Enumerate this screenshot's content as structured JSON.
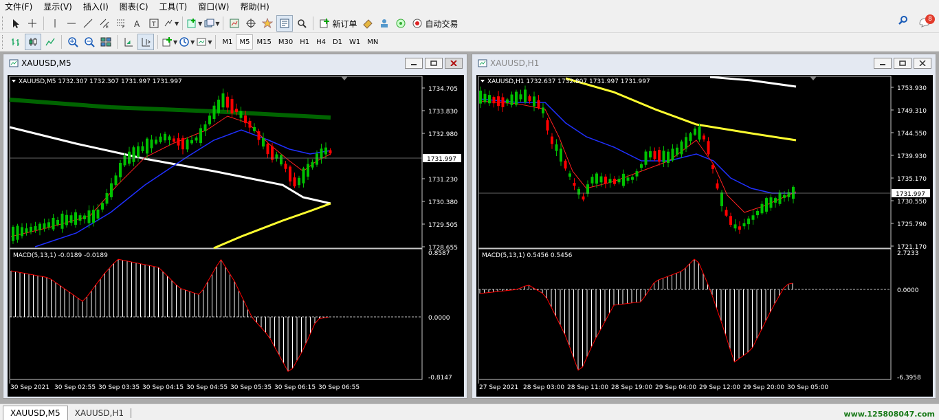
{
  "menu": [
    "文件(F)",
    "显示(V)",
    "插入(I)",
    "图表(C)",
    "工具(T)",
    "窗口(W)",
    "帮助(H)"
  ],
  "toolbar": {
    "new_order_label": "新订单",
    "auto_trading_label": "自动交易",
    "notification_count": "8"
  },
  "timeframes": [
    "M1",
    "M5",
    "M15",
    "M30",
    "H1",
    "H4",
    "D1",
    "W1",
    "MN"
  ],
  "active_timeframe": "M5",
  "windows": [
    {
      "title": "XAUUSD,M5",
      "active": true,
      "info": "XAUUSD,M5  1732.307 1732.307 1731.997 1731.997",
      "price_labels": [
        "1734.705",
        "1733.830",
        "1732.980",
        "1731.230",
        "1730.380",
        "1729.505",
        "1728.655"
      ],
      "current_price": "1731.997",
      "macd_label": "MACD(5,13,1) -0.0189 -0.0189",
      "macd_levels": [
        "0.8587",
        "0.0000",
        "-0.8147"
      ],
      "time_labels": [
        "30 Sep 2021",
        "30 Sep 02:55",
        "30 Sep 03:35",
        "30 Sep 04:15",
        "30 Sep 04:55",
        "30 Sep 05:35",
        "30 Sep 06:15",
        "30 Sep 06:55"
      ]
    },
    {
      "title": "XAUUSD,H1",
      "active": false,
      "info": "XAUUSD,H1  1732.637 1732.807 1731.997 1731.997",
      "price_labels": [
        "1753.930",
        "1749.310",
        "1744.550",
        "1739.930",
        "1735.170",
        "1730.550",
        "1725.790",
        "1721.170"
      ],
      "current_price": "1731.997",
      "macd_label": "MACD(5,13,1) 0.5456 0.5456",
      "macd_levels": [
        "2.7233",
        "0.0000",
        "-6.3958"
      ],
      "time_labels": [
        "27 Sep 2021",
        "28 Sep 03:00",
        "28 Sep 11:00",
        "28 Sep 19:00",
        "29 Sep 04:00",
        "29 Sep 12:00",
        "29 Sep 20:00",
        "30 Sep 05:00"
      ]
    }
  ],
  "tabs": [
    "XAUUSD,M5",
    "XAUUSD,H1"
  ],
  "watermark": "www.125808047.com",
  "colors": {
    "bull": "#00c000",
    "bear": "#ff0000",
    "ma_fast": "#ff2020",
    "ma_mid": "#2030ff",
    "ma_white": "#ffffff",
    "ma_yellow": "#ffff30",
    "ma_green": "#006400"
  }
}
